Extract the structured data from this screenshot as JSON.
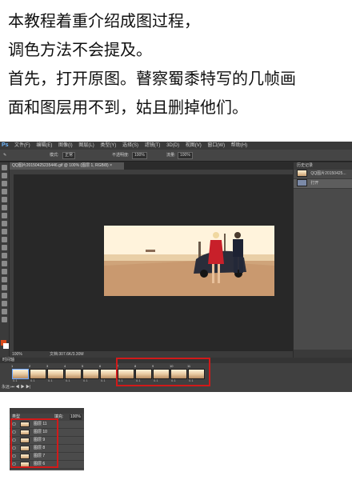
{
  "article": {
    "lines": [
      "本教程着重介绍成图过程，",
      "调色方法不会提及。",
      "首先，打开原图。瞽察蜀黍特写的几帧画",
      "面和图层用不到，姑且删掉他们。"
    ]
  },
  "photoshop": {
    "logo": "Ps",
    "menus": [
      "文件(F)",
      "编辑(E)",
      "图像(I)",
      "图层(L)",
      "类型(Y)",
      "选择(S)",
      "滤镜(T)",
      "3D(D)",
      "视图(V)",
      "窗口(W)",
      "帮助(H)"
    ],
    "options": {
      "mode_label": "模式:",
      "mode_value": "正常",
      "opacity_label": "不透明度:",
      "opacity_value": "100%",
      "flow_label": "流量:",
      "flow_value": "100%"
    },
    "document_tab": "QQ图片20150425235446.gif @ 100% (图层 1, RGB/8) ×",
    "status": {
      "zoom": "100%",
      "doc_size": "文档:307.6K/3.30M"
    },
    "history_panel": {
      "title": "历史记录",
      "snapshot": "QQ图片20150425...",
      "state": "打开"
    },
    "timeline": {
      "title": "时间轴",
      "frames": [
        {
          "num": "1",
          "time": "0.1"
        },
        {
          "num": "2",
          "time": "0.1"
        },
        {
          "num": "3",
          "time": "0.1"
        },
        {
          "num": "4",
          "time": "0.1"
        },
        {
          "num": "5",
          "time": "0.1"
        },
        {
          "num": "6",
          "time": "0.1"
        },
        {
          "num": "7",
          "time": "0.1"
        },
        {
          "num": "8",
          "time": "0.1"
        },
        {
          "num": "9",
          "time": "0.1"
        },
        {
          "num": "10",
          "time": "0.1"
        },
        {
          "num": "11",
          "time": "0.1"
        }
      ],
      "loop": "永远"
    }
  },
  "layers_panel": {
    "kind_label": "类型",
    "fill_label": "填充:",
    "fill_value": "100%",
    "layers": [
      "图层 11",
      "图层 10",
      "图层 9",
      "图层 8",
      "图层 7",
      "图层 6"
    ]
  },
  "colors": {
    "highlight": "#d11a1a",
    "ps_background": "#2b2b2b",
    "ps_logo": "#6fb8ff"
  }
}
